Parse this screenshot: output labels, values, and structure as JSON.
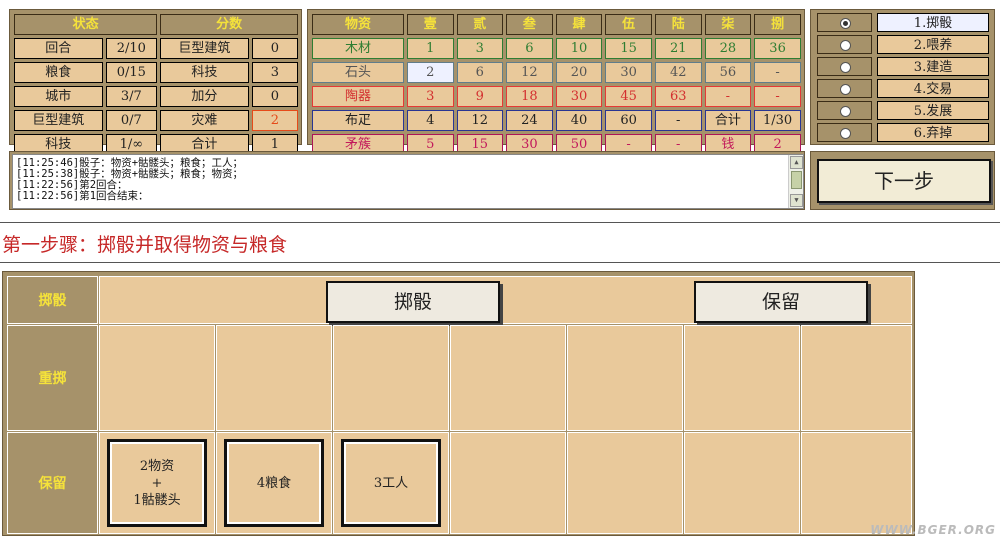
{
  "status": {
    "headers": [
      "状态",
      "分数"
    ],
    "rows": [
      [
        "回合",
        "2/10",
        "巨型建筑",
        "0"
      ],
      [
        "粮食",
        "0/15",
        "科技",
        "3"
      ],
      [
        "城市",
        "3/7",
        "加分",
        "0"
      ],
      [
        "巨型建筑",
        "0/7",
        "灾难",
        "2"
      ],
      [
        "科技",
        "1/∞",
        "合计",
        "1"
      ]
    ]
  },
  "resources": {
    "headers": [
      "物资",
      "壹",
      "贰",
      "叁",
      "肆",
      "伍",
      "陆",
      "柒",
      "捌"
    ],
    "rows": [
      [
        "木材",
        "1",
        "3",
        "6",
        "10",
        "15",
        "21",
        "28",
        "36"
      ],
      [
        "石头",
        "2",
        "6",
        "12",
        "20",
        "30",
        "42",
        "56",
        "-"
      ],
      [
        "陶器",
        "3",
        "9",
        "18",
        "30",
        "45",
        "63",
        "-",
        "-"
      ],
      [
        "布疋",
        "4",
        "12",
        "24",
        "40",
        "60",
        "-",
        "合计",
        "1/30"
      ],
      [
        "矛簇",
        "5",
        "15",
        "30",
        "50",
        "-",
        "-",
        "钱",
        "2"
      ]
    ]
  },
  "actions": {
    "items": [
      "1.掷骰",
      "2.喂养",
      "3.建造",
      "4.交易",
      "5.发展",
      "6.弃掉"
    ],
    "selected_index": 0
  },
  "log": {
    "lines": [
      "[11:25:46]骰子：物资+骷髅头；粮食；工人；",
      "[11:25:38]骰子：物资+骷髅头；粮食；物资；",
      "[11:22:56]第2回合：",
      "[11:22:56]第1回合结束："
    ]
  },
  "next_button": "下一步",
  "step_title": "第一步骤：掷骰并取得物资与粮食",
  "board": {
    "roll_label": "掷骰",
    "reroll_label": "重掷",
    "keep_label": "保留",
    "roll_button": "掷骰",
    "keep_button": "保留",
    "kept_dice": [
      [
        "2物资",
        "+",
        "1骷髅头"
      ],
      [
        "4粮食"
      ],
      [
        "3工人"
      ]
    ]
  },
  "watermark": "WWW.BGER.ORG",
  "colors": {
    "panel": "#a6926a",
    "cell": "#e9c99b",
    "header_text": "#f5e23a",
    "title_red": "#c62828"
  }
}
